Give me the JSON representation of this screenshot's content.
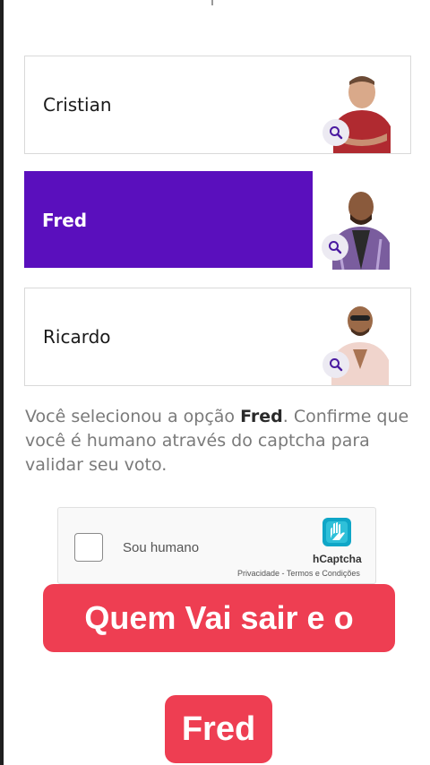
{
  "options": [
    {
      "name": "Cristian",
      "selected": false
    },
    {
      "name": "Fred",
      "selected": true
    },
    {
      "name": "Ricardo",
      "selected": false
    }
  ],
  "info": {
    "prefix": "Você selecionou a opção ",
    "selected_name": "Fred",
    "suffix": ". Confirme que você é humano através do captcha para validar seu voto."
  },
  "captcha": {
    "label": "Sou humano",
    "brand": "hCaptcha",
    "links": "Privacidade - Termos e Condições"
  },
  "overlay": {
    "banner": "Quem Vai sair e o",
    "badge": "Fred"
  },
  "colors": {
    "selected": "#5a0fbd",
    "overlay_red": "#ee3e52",
    "zoom_icon": "#4a1aa0"
  },
  "icons": [
    "magnifier-icon",
    "hcaptcha-logo-icon"
  ]
}
